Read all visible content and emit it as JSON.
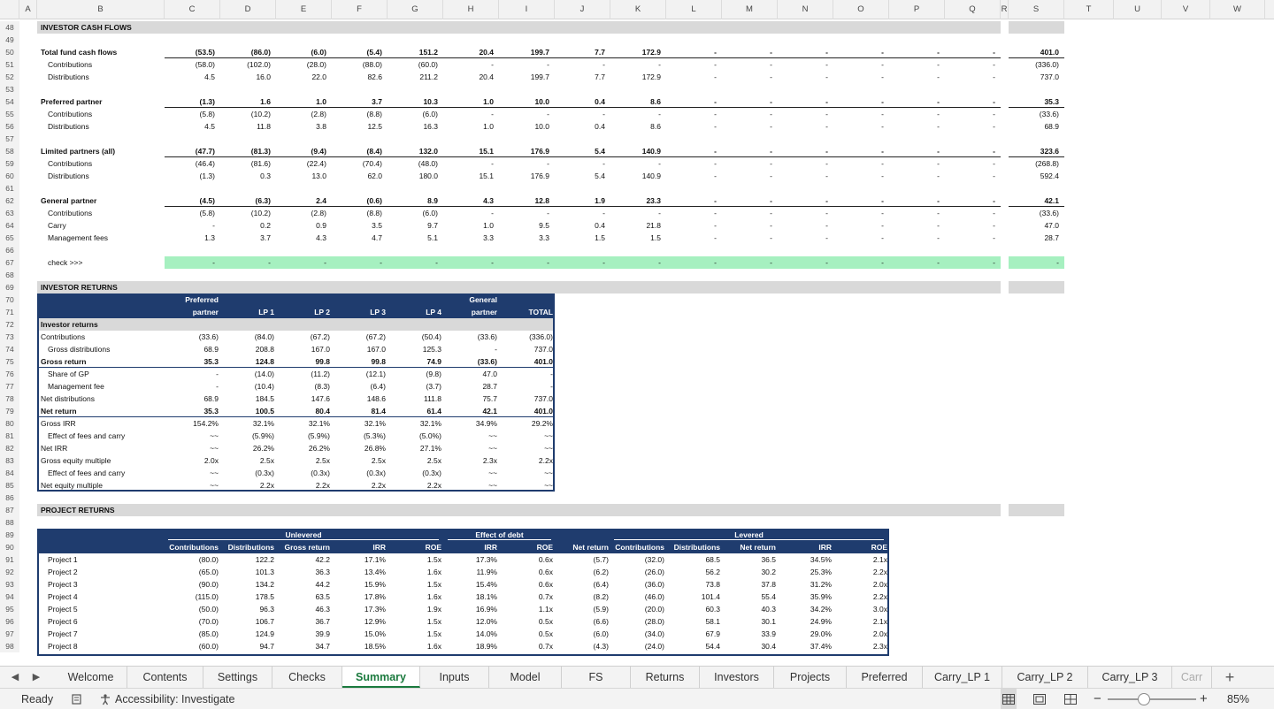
{
  "columns": [
    "A",
    "B",
    "C",
    "D",
    "E",
    "F",
    "G",
    "H",
    "I",
    "J",
    "K",
    "L",
    "M",
    "N",
    "O",
    "P",
    "Q",
    "R",
    "S",
    "T",
    "U",
    "V",
    "W"
  ],
  "cash_flows": {
    "header": "INVESTOR CASH FLOWS",
    "rows": [
      {
        "n": "48"
      },
      {
        "n": "49"
      },
      {
        "n": "50",
        "label": "Total fund cash flows",
        "bold": true,
        "ul": true,
        "v": [
          "(53.5)",
          "(86.0)",
          "(6.0)",
          "(5.4)",
          "151.2",
          "20.4",
          "199.7",
          "7.7",
          "172.9",
          "-",
          "-",
          "-",
          "-",
          "-",
          "-",
          "401.0"
        ]
      },
      {
        "n": "51",
        "label": "Contributions",
        "indent": true,
        "v": [
          "(58.0)",
          "(102.0)",
          "(28.0)",
          "(88.0)",
          "(60.0)",
          "-",
          "-",
          "-",
          "-",
          "-",
          "-",
          "-",
          "-",
          "-",
          "-",
          "(336.0)"
        ]
      },
      {
        "n": "52",
        "label": "Distributions",
        "indent": true,
        "v": [
          "4.5",
          "16.0",
          "22.0",
          "82.6",
          "211.2",
          "20.4",
          "199.7",
          "7.7",
          "172.9",
          "-",
          "-",
          "-",
          "-",
          "-",
          "-",
          "737.0"
        ]
      },
      {
        "n": "53"
      },
      {
        "n": "54",
        "label": "Preferred partner",
        "bold": true,
        "ul": true,
        "v": [
          "(1.3)",
          "1.6",
          "1.0",
          "3.7",
          "10.3",
          "1.0",
          "10.0",
          "0.4",
          "8.6",
          "-",
          "-",
          "-",
          "-",
          "-",
          "-",
          "35.3"
        ]
      },
      {
        "n": "55",
        "label": "Contributions",
        "indent": true,
        "v": [
          "(5.8)",
          "(10.2)",
          "(2.8)",
          "(8.8)",
          "(6.0)",
          "-",
          "-",
          "-",
          "-",
          "-",
          "-",
          "-",
          "-",
          "-",
          "-",
          "(33.6)"
        ]
      },
      {
        "n": "56",
        "label": "Distributions",
        "indent": true,
        "v": [
          "4.5",
          "11.8",
          "3.8",
          "12.5",
          "16.3",
          "1.0",
          "10.0",
          "0.4",
          "8.6",
          "-",
          "-",
          "-",
          "-",
          "-",
          "-",
          "68.9"
        ]
      },
      {
        "n": "57"
      },
      {
        "n": "58",
        "label": "Limited partners (all)",
        "bold": true,
        "ul": true,
        "v": [
          "(47.7)",
          "(81.3)",
          "(9.4)",
          "(8.4)",
          "132.0",
          "15.1",
          "176.9",
          "5.4",
          "140.9",
          "-",
          "-",
          "-",
          "-",
          "-",
          "-",
          "323.6"
        ]
      },
      {
        "n": "59",
        "label": "Contributions",
        "indent": true,
        "v": [
          "(46.4)",
          "(81.6)",
          "(22.4)",
          "(70.4)",
          "(48.0)",
          "-",
          "-",
          "-",
          "-",
          "-",
          "-",
          "-",
          "-",
          "-",
          "-",
          "(268.8)"
        ]
      },
      {
        "n": "60",
        "label": "Distributions",
        "indent": true,
        "v": [
          "(1.3)",
          "0.3",
          "13.0",
          "62.0",
          "180.0",
          "15.1",
          "176.9",
          "5.4",
          "140.9",
          "-",
          "-",
          "-",
          "-",
          "-",
          "-",
          "592.4"
        ]
      },
      {
        "n": "61"
      },
      {
        "n": "62",
        "label": "General partner",
        "bold": true,
        "ul": true,
        "v": [
          "(4.5)",
          "(6.3)",
          "2.4",
          "(0.6)",
          "8.9",
          "4.3",
          "12.8",
          "1.9",
          "23.3",
          "-",
          "-",
          "-",
          "-",
          "-",
          "-",
          "42.1"
        ]
      },
      {
        "n": "63",
        "label": "Contributions",
        "indent": true,
        "v": [
          "(5.8)",
          "(10.2)",
          "(2.8)",
          "(8.8)",
          "(6.0)",
          "-",
          "-",
          "-",
          "-",
          "-",
          "-",
          "-",
          "-",
          "-",
          "-",
          "(33.6)"
        ]
      },
      {
        "n": "64",
        "label": "Carry",
        "indent": true,
        "v": [
          "-",
          "0.2",
          "0.9",
          "3.5",
          "9.7",
          "1.0",
          "9.5",
          "0.4",
          "21.8",
          "-",
          "-",
          "-",
          "-",
          "-",
          "-",
          "47.0"
        ]
      },
      {
        "n": "65",
        "label": "Management fees",
        "indent": true,
        "v": [
          "1.3",
          "3.7",
          "4.3",
          "4.7",
          "5.1",
          "3.3",
          "3.3",
          "1.5",
          "1.5",
          "-",
          "-",
          "-",
          "-",
          "-",
          "-",
          "28.7"
        ]
      },
      {
        "n": "66"
      },
      {
        "n": "67",
        "label": "check >>>",
        "indent": true,
        "check": true,
        "v": [
          "-",
          "-",
          "-",
          "-",
          "-",
          "-",
          "-",
          "-",
          "-",
          "-",
          "-",
          "-",
          "-",
          "-",
          "-",
          "-"
        ]
      },
      {
        "n": "68"
      }
    ]
  },
  "investor_returns": {
    "header": "INVESTOR RETURNS",
    "col_headers_top": [
      "Preferred",
      "",
      "",
      "",
      "",
      "General",
      ""
    ],
    "col_headers": [
      "partner",
      "LP 1",
      "LP 2",
      "LP 3",
      "LP 4",
      "partner",
      "TOTAL"
    ],
    "section_label": "Investor returns",
    "rows": [
      {
        "n": "73",
        "label": "Contributions",
        "v": [
          "(33.6)",
          "(84.0)",
          "(67.2)",
          "(67.2)",
          "(50.4)",
          "(33.6)",
          "(336.0)"
        ]
      },
      {
        "n": "74",
        "label": "Gross distributions",
        "indent": true,
        "v": [
          "68.9",
          "208.8",
          "167.0",
          "167.0",
          "125.3",
          "-",
          "737.0"
        ]
      },
      {
        "n": "75",
        "label": "Gross return",
        "bold": true,
        "v": [
          "35.3",
          "124.8",
          "99.8",
          "99.8",
          "74.9",
          "(33.6)",
          "401.0"
        ]
      },
      {
        "n": "76",
        "label": "Share of GP",
        "indent": true,
        "v": [
          "-",
          "(14.0)",
          "(11.2)",
          "(12.1)",
          "(9.8)",
          "47.0",
          "-"
        ]
      },
      {
        "n": "77",
        "label": "Management fee",
        "indent": true,
        "v": [
          "-",
          "(10.4)",
          "(8.3)",
          "(6.4)",
          "(3.7)",
          "28.7",
          "-"
        ]
      },
      {
        "n": "78",
        "label": "Net distributions",
        "v": [
          "68.9",
          "184.5",
          "147.6",
          "148.6",
          "111.8",
          "75.7",
          "737.0"
        ]
      },
      {
        "n": "79",
        "label": "Net return",
        "bold": true,
        "v": [
          "35.3",
          "100.5",
          "80.4",
          "81.4",
          "61.4",
          "42.1",
          "401.0"
        ]
      },
      {
        "n": "80",
        "label": "Gross IRR",
        "v": [
          "154.2%",
          "32.1%",
          "32.1%",
          "32.1%",
          "32.1%",
          "34.9%",
          "29.2%"
        ]
      },
      {
        "n": "81",
        "label": "Effect of fees and carry",
        "indent": true,
        "v": [
          "~~",
          "(5.9%)",
          "(5.9%)",
          "(5.3%)",
          "(5.0%)",
          "~~",
          "~~"
        ]
      },
      {
        "n": "82",
        "label": "Net IRR",
        "v": [
          "~~",
          "26.2%",
          "26.2%",
          "26.8%",
          "27.1%",
          "~~",
          "~~"
        ]
      },
      {
        "n": "83",
        "label": "Gross equity multiple",
        "v": [
          "2.0x",
          "2.5x",
          "2.5x",
          "2.5x",
          "2.5x",
          "2.3x",
          "2.2x"
        ]
      },
      {
        "n": "84",
        "label": "Effect of fees and carry",
        "indent": true,
        "v": [
          "~~",
          "(0.3x)",
          "(0.3x)",
          "(0.3x)",
          "(0.3x)",
          "~~",
          "~~"
        ]
      },
      {
        "n": "85",
        "label": "Net equity multiple",
        "v": [
          "~~",
          "2.2x",
          "2.2x",
          "2.2x",
          "2.2x",
          "~~",
          "~~"
        ]
      }
    ]
  },
  "project_returns": {
    "header": "PROJECT RETURNS",
    "groups": [
      "Unlevered",
      "Effect of debt",
      "Levered"
    ],
    "col_headers": [
      "Contributions",
      "Distributions",
      "Gross return",
      "IRR",
      "ROE",
      "IRR",
      "ROE",
      "Net return",
      "Contributions",
      "Distributions",
      "Net return",
      "IRR",
      "ROE"
    ],
    "rows": [
      {
        "n": "91",
        "label": "Project 1",
        "v": [
          "(80.0)",
          "122.2",
          "42.2",
          "17.1%",
          "1.5x",
          "17.3%",
          "0.6x",
          "(5.7)",
          "(32.0)",
          "68.5",
          "36.5",
          "34.5%",
          "2.1x"
        ]
      },
      {
        "n": "92",
        "label": "Project 2",
        "v": [
          "(65.0)",
          "101.3",
          "36.3",
          "13.4%",
          "1.6x",
          "11.9%",
          "0.6x",
          "(6.2)",
          "(26.0)",
          "56.2",
          "30.2",
          "25.3%",
          "2.2x"
        ]
      },
      {
        "n": "93",
        "label": "Project 3",
        "v": [
          "(90.0)",
          "134.2",
          "44.2",
          "15.9%",
          "1.5x",
          "15.4%",
          "0.6x",
          "(6.4)",
          "(36.0)",
          "73.8",
          "37.8",
          "31.2%",
          "2.0x"
        ]
      },
      {
        "n": "94",
        "label": "Project 4",
        "v": [
          "(115.0)",
          "178.5",
          "63.5",
          "17.8%",
          "1.6x",
          "18.1%",
          "0.7x",
          "(8.2)",
          "(46.0)",
          "101.4",
          "55.4",
          "35.9%",
          "2.2x"
        ]
      },
      {
        "n": "95",
        "label": "Project 5",
        "v": [
          "(50.0)",
          "96.3",
          "46.3",
          "17.3%",
          "1.9x",
          "16.9%",
          "1.1x",
          "(5.9)",
          "(20.0)",
          "60.3",
          "40.3",
          "34.2%",
          "3.0x"
        ]
      },
      {
        "n": "96",
        "label": "Project 6",
        "v": [
          "(70.0)",
          "106.7",
          "36.7",
          "12.9%",
          "1.5x",
          "12.0%",
          "0.5x",
          "(6.6)",
          "(28.0)",
          "58.1",
          "30.1",
          "24.9%",
          "2.1x"
        ]
      },
      {
        "n": "97",
        "label": "Project 7",
        "v": [
          "(85.0)",
          "124.9",
          "39.9",
          "15.0%",
          "1.5x",
          "14.0%",
          "0.5x",
          "(6.0)",
          "(34.0)",
          "67.9",
          "33.9",
          "29.0%",
          "2.0x"
        ]
      },
      {
        "n": "98",
        "label": "Project 8",
        "v": [
          "(60.0)",
          "94.7",
          "34.7",
          "18.5%",
          "1.6x",
          "18.9%",
          "0.7x",
          "(4.3)",
          "(24.0)",
          "54.4",
          "30.4",
          "37.4%",
          "2.3x"
        ]
      }
    ]
  },
  "tabs": [
    "Welcome",
    "Contents",
    "Settings",
    "Checks",
    "Summary",
    "Inputs",
    "Model",
    "FS",
    "Returns",
    "Investors",
    "Projects",
    "Preferred",
    "Carry_LP 1",
    "Carry_LP 2",
    "Carry_LP 3",
    "Carr"
  ],
  "active_tab": "Summary",
  "status": {
    "ready": "Ready",
    "accessibility": "Accessibility: Investigate",
    "zoom": "85%"
  },
  "icons": {
    "prev": "chevron-left-icon",
    "next": "chevron-right-icon",
    "add": "plus-icon"
  },
  "colors": {
    "navy": "#1f3c6e",
    "check_green": "#a6f0c0",
    "active_tab": "#1b7a3e",
    "section_bar": "#d9d9d9"
  }
}
